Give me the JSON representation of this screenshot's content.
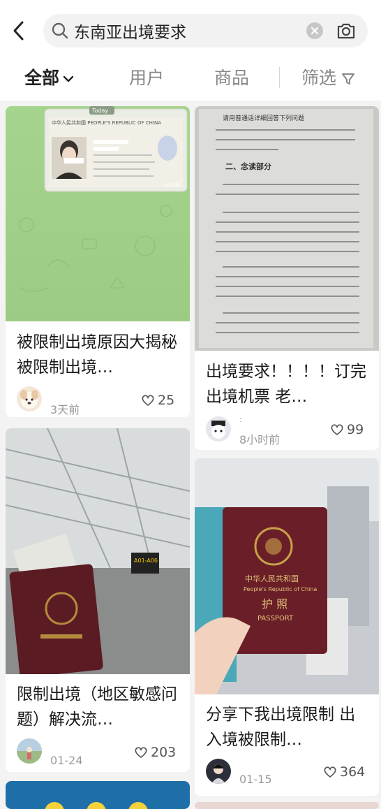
{
  "search": {
    "value": "东南亚出境要求"
  },
  "tabs": {
    "all": "全部",
    "users": "用户",
    "products": "商品",
    "filter": "筛选"
  },
  "cards": [
    {
      "title": "被限制出境原因大揭秘 被限制出境…",
      "time": "3天前",
      "likes": "25",
      "image": {
        "badge": "Today",
        "time": "18:08",
        "passport_header": "中华人民共和国  PEOPLE'S REPUBLIC OF CHINA"
      }
    },
    {
      "title": "出境要求！！！！订完出境机票 老…",
      "user": ":",
      "time": "8小时前",
      "likes": "99",
      "image": {
        "heading": "请用普通话详细回答下列问题",
        "section": "二、念读部分"
      }
    },
    {
      "title": "限制出境（地区敏感问题）解决流…",
      "time": "01-24",
      "likes": "203",
      "image": {
        "gate_sign": "A01-A06"
      }
    },
    {
      "title": "分享下我出境限制 出入境被限制…",
      "time": "01-15",
      "likes": "364",
      "image": {
        "cover_cn": "中华人民共和国",
        "cover_en": "People's Republic of China",
        "cover_title": "护 照",
        "cover_passport": "PASSPORT"
      }
    }
  ]
}
